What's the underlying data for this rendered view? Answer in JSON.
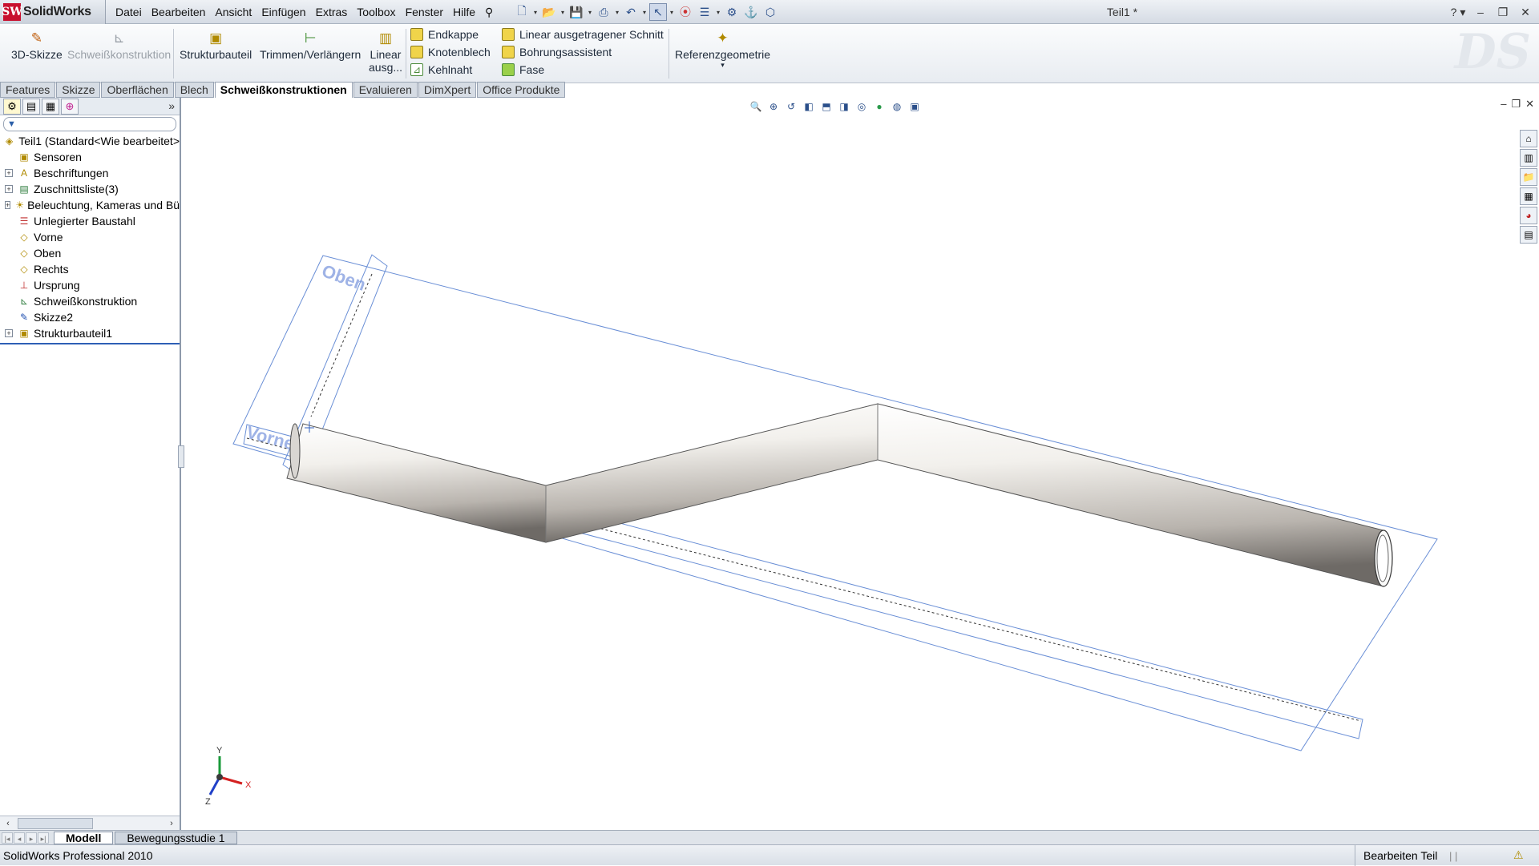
{
  "app": {
    "logo_text": "SolidWorks",
    "logo_mark": "SW",
    "document_title": "Teil1 *"
  },
  "menu": [
    "Datei",
    "Bearbeiten",
    "Ansicht",
    "Einfügen",
    "Extras",
    "Toolbox",
    "Fenster",
    "Hilfe"
  ],
  "command_manager": {
    "sketch3d": "3D-Skizze",
    "weldment": "Schweißkonstruktion",
    "structural_member": "Strukturbauteil",
    "trim_extend": "Trimmen/Verlängern",
    "linear_cut_1": "Linear",
    "linear_cut_2": "ausg...",
    "end_cap": "Endkappe",
    "gusset": "Knotenblech",
    "fillet_bead": "Kehlnaht",
    "extruded_cut": "Linear ausgetragener Schnitt",
    "hole_wizard": "Bohrungsassistent",
    "chamfer": "Fase",
    "reference_geometry": "Referenzgeometrie"
  },
  "cm_tabs": [
    "Features",
    "Skizze",
    "Oberflächen",
    "Blech",
    "Schweißkonstruktionen",
    "Evaluieren",
    "DimXpert",
    "Office Produkte"
  ],
  "cm_tabs_active": "Schweißkonstruktionen",
  "tree": {
    "root": "Teil1  (Standard<Wie bearbeitet>",
    "items": [
      {
        "label": "Sensoren",
        "expandable": false,
        "icon": "sensor-folder-icon"
      },
      {
        "label": "Beschriftungen",
        "expandable": true,
        "icon": "annotations-icon"
      },
      {
        "label": "Zuschnittsliste(3)",
        "expandable": true,
        "icon": "cut-list-icon"
      },
      {
        "label": "Beleuchtung, Kameras und Bü",
        "expandable": true,
        "icon": "lights-cameras-icon"
      },
      {
        "label": "Unlegierter Baustahl",
        "expandable": false,
        "icon": "material-icon"
      },
      {
        "label": "Vorne",
        "expandable": false,
        "icon": "plane-icon"
      },
      {
        "label": "Oben",
        "expandable": false,
        "icon": "plane-icon"
      },
      {
        "label": "Rechts",
        "expandable": false,
        "icon": "plane-icon"
      },
      {
        "label": "Ursprung",
        "expandable": false,
        "icon": "origin-icon"
      },
      {
        "label": "Schweißkonstruktion",
        "expandable": false,
        "icon": "weldment-icon"
      },
      {
        "label": "Skizze2",
        "expandable": false,
        "icon": "sketch-icon"
      },
      {
        "label": "Strukturbauteil1",
        "expandable": true,
        "icon": "structural-member-icon"
      }
    ]
  },
  "viewport": {
    "plane_labels": {
      "top": "Oben",
      "front": "Vorne"
    },
    "triad": {
      "x": "X",
      "y": "Y",
      "z": "Z"
    }
  },
  "bottom_tabs": [
    "Modell",
    "Bewegungsstudie 1"
  ],
  "bottom_tabs_active": "Modell",
  "status": {
    "product": "SolidWorks Professional 2010",
    "mode": "Bearbeiten Teil"
  },
  "colors": {
    "plane_outline": "#6a8fd6",
    "tube_shade": "#6e6a66",
    "triad_x": "#d42020",
    "triad_y": "#1a9a3a",
    "triad_z": "#2040c8"
  }
}
